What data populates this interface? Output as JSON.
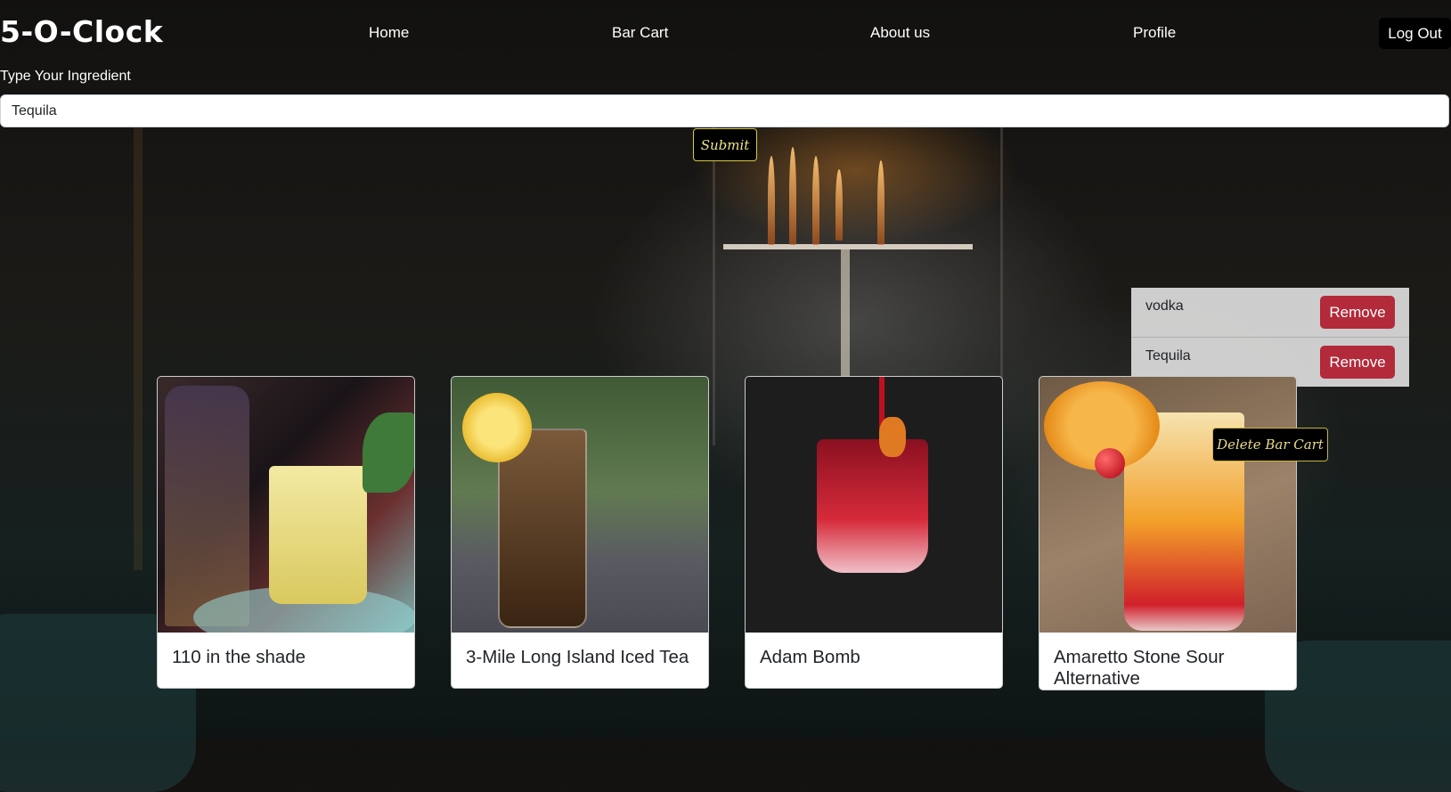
{
  "nav": {
    "logo": "5-O-Clock",
    "links": [
      "Home",
      "Bar Cart",
      "About us",
      "Profile"
    ],
    "logout": "Log Out"
  },
  "search": {
    "label": "Type Your Ingredient",
    "value": "Tequila",
    "submit": "Submit"
  },
  "bar_cart": {
    "items": [
      {
        "name": "vodka",
        "action": "Remove"
      },
      {
        "name": "Tequila",
        "action": "Remove"
      }
    ],
    "delete": "Delete Bar Cart"
  },
  "drinks": [
    {
      "name": "110 in the shade"
    },
    {
      "name": "3-Mile Long Island Iced Tea"
    },
    {
      "name": "Adam Bomb"
    },
    {
      "name": "Amaretto Stone Sour Alternative"
    }
  ],
  "colors": {
    "remove_button": "#b32a3a",
    "submit_border": "#d8c943",
    "card_background": "#ffffff"
  }
}
